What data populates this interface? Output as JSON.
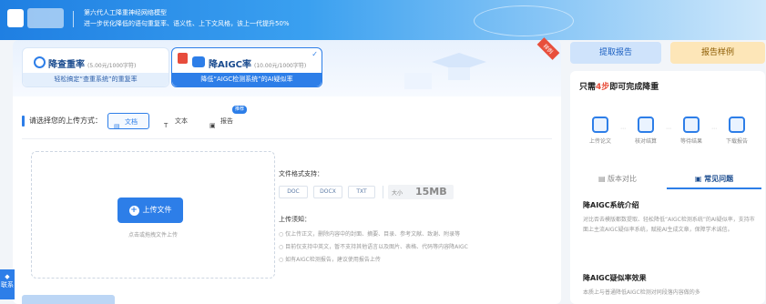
{
  "top_bar": {
    "line1": "第六代人工降重神经网络模型",
    "line2": "进一步优化降低的语句重复率、语义性、上下文风格，该上一代提升50%"
  },
  "hero": {
    "card1": {
      "title": "降查重率",
      "price": "(5.00元/1000字符)",
      "subtitle": "轻松搞定“查重系统”的重复率"
    },
    "card2": {
      "title": "降AIGC率",
      "price": "(10.00元/1000字符)",
      "subtitle": "降低“AIGC检测系统”的AI疑似率"
    },
    "ribbon": "样例"
  },
  "upload_section": {
    "label": "请选择您的上传方式：",
    "types": [
      {
        "label": "文档",
        "icon": "document-icon",
        "active": true
      },
      {
        "label": "文本",
        "icon": "text-icon"
      },
      {
        "label": "报告",
        "icon": "report-icon",
        "tag": "推荐"
      }
    ],
    "upload_button": "上传文件",
    "upload_hint": "点击或拖拽文件上传",
    "format_label": "文件格式支持：",
    "formats": [
      "DOC",
      "DOCX",
      "TXT"
    ],
    "size_prefix": "大小",
    "size_limit": "15MB",
    "notes_title": "上传须知：",
    "notes": [
      "仅上传正文，删除内容中的封面、摘要、目录、参考文献、致谢、附录等",
      "目前仅支持中英文，暂不支持其他语言以及图片、表格、代码等内容降AIGC",
      "如有AIGC检测报告，建议使用报告上传"
    ]
  },
  "side_tab": "联系",
  "right": {
    "extract_button": "提取报告",
    "sample_button": "报告样例",
    "steps_title_pre": "只需",
    "steps_title_hl": "4步",
    "steps_title_post": "即可完成降重",
    "steps": [
      "上传论文",
      "核对结算",
      "等待结果",
      "下载报告"
    ],
    "tabs": [
      "版本对比",
      "常见问题"
    ],
    "faq1_title": "降AIGC系统介绍",
    "faq1_body": "对比否去模版都数提取、轻松降低“AIGC检测系统”的AI疑似率，支持市面上主流AIGC疑似率系统，赋能AI生成文章，保障学术诚信。",
    "faq2_title": "降AIGC疑似率效果",
    "faq2_body": "本质上与普通降低AIGC检测对同段落内容做的多"
  }
}
